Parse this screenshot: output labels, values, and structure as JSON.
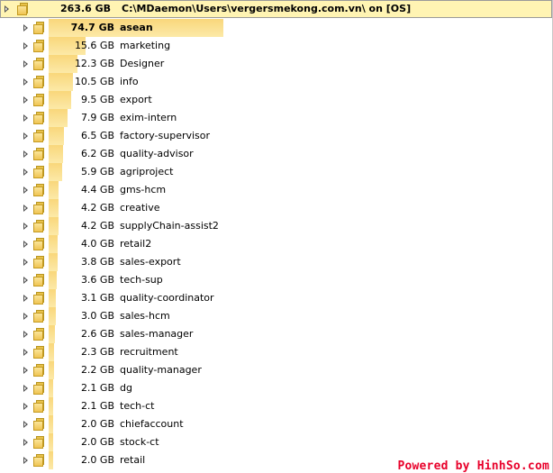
{
  "root": {
    "size": "263.6 GB",
    "path": "C:\\MDaemon\\Users\\vergersmekong.com.vn\\ on [OS]"
  },
  "items": [
    {
      "size": "74.7 GB",
      "name": "asean",
      "fraction": 1.0
    },
    {
      "size": "15.6 GB",
      "name": "marketing",
      "fraction": 0.209
    },
    {
      "size": "12.3 GB",
      "name": "Designer",
      "fraction": 0.165
    },
    {
      "size": "10.5 GB",
      "name": "info",
      "fraction": 0.141
    },
    {
      "size": "9.5 GB",
      "name": "export",
      "fraction": 0.127
    },
    {
      "size": "7.9 GB",
      "name": "exim-intern",
      "fraction": 0.106
    },
    {
      "size": "6.5 GB",
      "name": "factory-supervisor",
      "fraction": 0.087
    },
    {
      "size": "6.2 GB",
      "name": "quality-advisor",
      "fraction": 0.083
    },
    {
      "size": "5.9 GB",
      "name": "agriproject",
      "fraction": 0.079
    },
    {
      "size": "4.4 GB",
      "name": "gms-hcm",
      "fraction": 0.059
    },
    {
      "size": "4.2 GB",
      "name": "creative",
      "fraction": 0.056
    },
    {
      "size": "4.2 GB",
      "name": "supplyChain-assist2",
      "fraction": 0.056
    },
    {
      "size": "4.0 GB",
      "name": "retail2",
      "fraction": 0.054
    },
    {
      "size": "3.8 GB",
      "name": "sales-export",
      "fraction": 0.051
    },
    {
      "size": "3.6 GB",
      "name": "tech-sup",
      "fraction": 0.048
    },
    {
      "size": "3.1 GB",
      "name": "quality-coordinator",
      "fraction": 0.041
    },
    {
      "size": "3.0 GB",
      "name": "sales-hcm",
      "fraction": 0.04
    },
    {
      "size": "2.6 GB",
      "name": "sales-manager",
      "fraction": 0.035
    },
    {
      "size": "2.3 GB",
      "name": "recruitment",
      "fraction": 0.031
    },
    {
      "size": "2.2 GB",
      "name": "quality-manager",
      "fraction": 0.029
    },
    {
      "size": "2.1 GB",
      "name": "dg",
      "fraction": 0.028
    },
    {
      "size": "2.1 GB",
      "name": "tech-ct",
      "fraction": 0.028
    },
    {
      "size": "2.0 GB",
      "name": "chiefaccount",
      "fraction": 0.027
    },
    {
      "size": "2.0 GB",
      "name": "stock-ct",
      "fraction": 0.027
    },
    {
      "size": "2.0 GB",
      "name": "retail",
      "fraction": 0.027
    }
  ],
  "colors": {
    "bar": "#fce9a8",
    "bar_top": "#f9d77b",
    "root_background": "#fff4b3",
    "watermark": "#e8002a"
  },
  "icons": {
    "expander": "triangle-right-icon",
    "folder": "folder-icon"
  },
  "watermark": "Powered by HinhSo.com"
}
